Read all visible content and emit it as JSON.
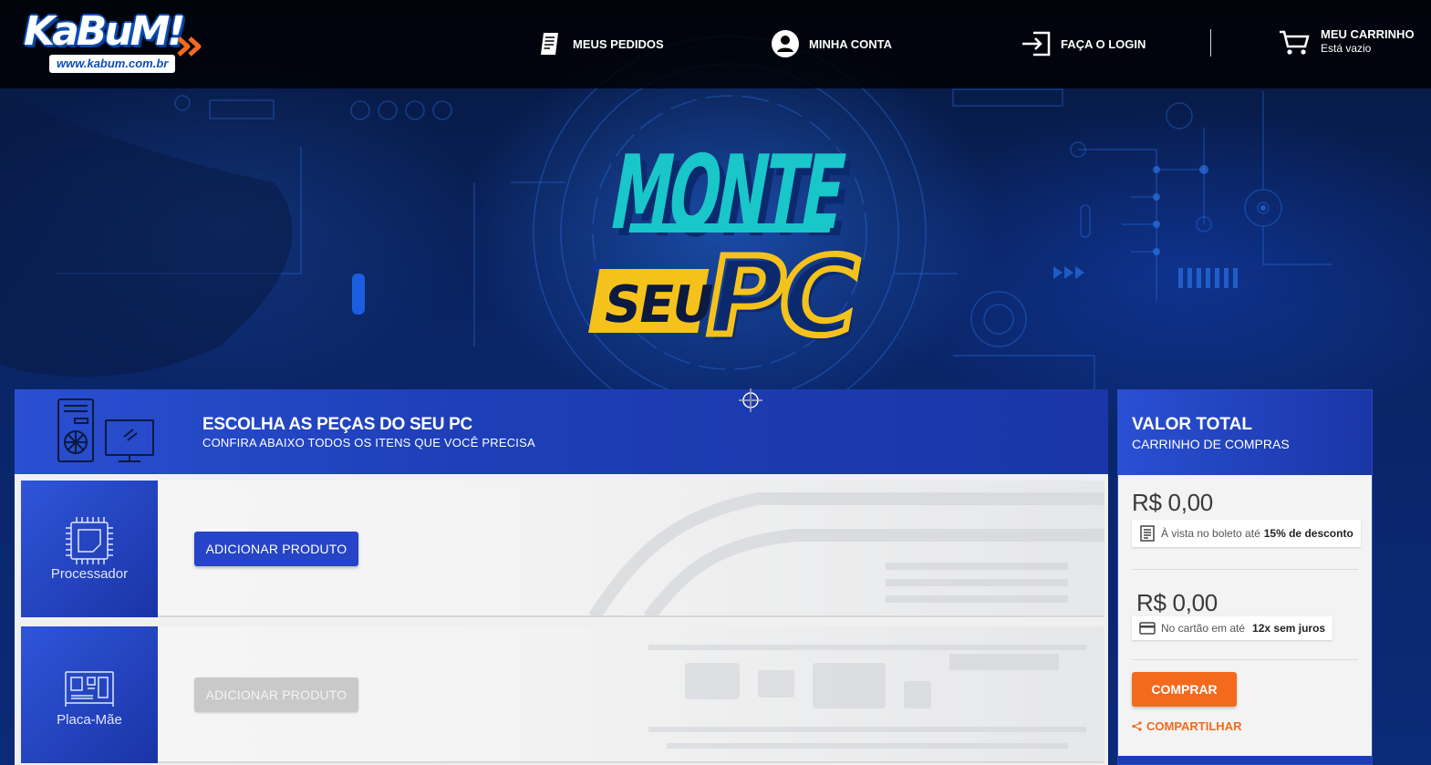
{
  "header": {
    "logo": {
      "brand": "KaBuM!",
      "url": "www.kabum.com.br"
    },
    "nav": [
      {
        "label": "MEUS PEDIDOS",
        "icon": "orders-icon"
      },
      {
        "label": "MINHA CONTA",
        "icon": "user-icon"
      },
      {
        "label": "FAÇA O LOGIN",
        "icon": "login-icon"
      }
    ],
    "cart": {
      "title": "MEU CARRINHO",
      "status": "Está vazio",
      "icon": "cart-icon"
    }
  },
  "hero": {
    "line1": "MONTE",
    "line2a": "SEU",
    "line2b": "PC"
  },
  "builder": {
    "title": "ESCOLHA AS PEÇAS DO SEU PC",
    "subtitle": "CONFIRA ABAIXO TODOS OS ITENS QUE VOCÊ PRECISA",
    "rows": [
      {
        "category": "Processador",
        "icon": "cpu-icon",
        "button": "ADICIONAR PRODUTO",
        "enabled": true
      },
      {
        "category": "Placa-Mãe",
        "icon": "motherboard-icon",
        "button": "ADICIONAR PRODUTO",
        "enabled": false
      }
    ]
  },
  "total": {
    "title": "VALOR TOTAL",
    "subtitle": "CARRINHO DE COMPRAS",
    "boleto": {
      "price": "R$ 0,00",
      "text": "À vista no boleto até",
      "highlight": "15% de desconto"
    },
    "card": {
      "price": "R$ 0,00",
      "text": "No cartão em até",
      "highlight": "12x sem juros"
    },
    "buy_label": "COMPRAR",
    "share_label": "COMPARTILHAR"
  },
  "colors": {
    "accent_blue": "#2544c8",
    "header_bg": "#000000",
    "buy_orange": "#f36a1d",
    "hero_teal": "#19c6c9",
    "hero_yellow": "#f5c21b"
  }
}
